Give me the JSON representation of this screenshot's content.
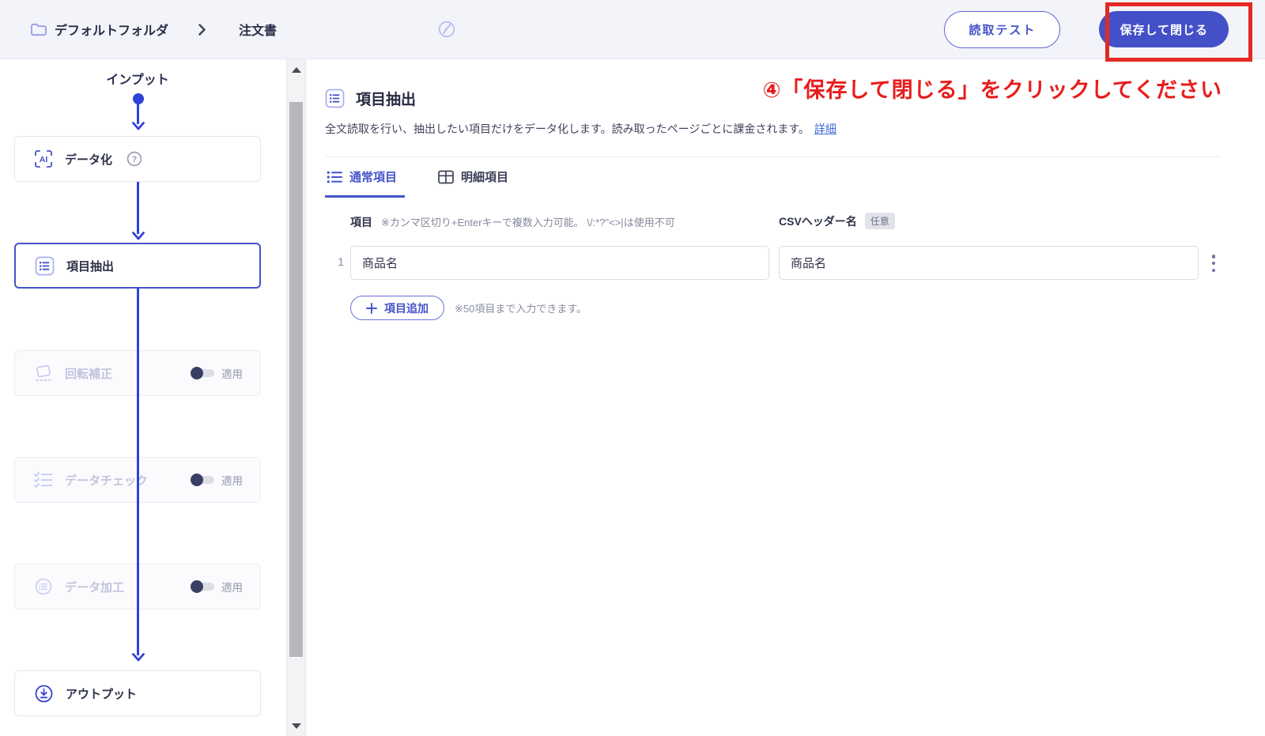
{
  "colors": {
    "accent": "#4450c8",
    "flow_line": "#3142d6",
    "annotation_red": "#e81c1c",
    "link_blue": "#3e6bd6",
    "topbar_bg": "#f3f4f9"
  },
  "topbar": {
    "folder_name": "デフォルトフォルダ",
    "document_name": "注文書",
    "test_button": "読取テスト",
    "save_button": "保存して閉じる"
  },
  "annotation": {
    "text": "④「保存して閉じる」をクリックしてください"
  },
  "sidebar": {
    "input_label": "インプット",
    "nodes": [
      {
        "label": "データ化",
        "icon": "ai-icon",
        "state": "normal",
        "help_icon": "help-icon"
      },
      {
        "label": "項目抽出",
        "icon": "list-icon",
        "state": "active"
      },
      {
        "label": "回転補正",
        "icon": "rotate-icon",
        "state": "disabled",
        "toggle_label": "適用",
        "toggle_state": "off"
      },
      {
        "label": "データチェック",
        "icon": "checklist-icon",
        "state": "disabled",
        "toggle_label": "適用",
        "toggle_state": "off"
      },
      {
        "label": "データ加工",
        "icon": "process-icon",
        "state": "disabled",
        "toggle_label": "適用",
        "toggle_state": "off"
      },
      {
        "label": "アウトプット",
        "icon": "output-icon",
        "state": "normal"
      }
    ]
  },
  "main": {
    "title": "項目抽出",
    "description": "全文読取を行い、抽出したい項目だけをデータ化します。読み取ったページごとに課金されます。",
    "detail_link": "詳細",
    "tabs": [
      {
        "label": "通常項目",
        "icon": "list-icon",
        "active": true
      },
      {
        "label": "明細項目",
        "icon": "table-icon",
        "active": false
      }
    ],
    "columns": {
      "item_label": "項目",
      "item_note": "※カンマ区切り+Enterキーで複数入力可能。 \\/:*?\"<>|は使用不可",
      "csv_label": "CSVヘッダー名",
      "csv_badge": "任意"
    },
    "rows": [
      {
        "index": "1",
        "item_value": "商品名",
        "csv_value": "商品名"
      }
    ],
    "add_button_label": "項目追加",
    "add_note": "※50項目まで入力できます。"
  }
}
